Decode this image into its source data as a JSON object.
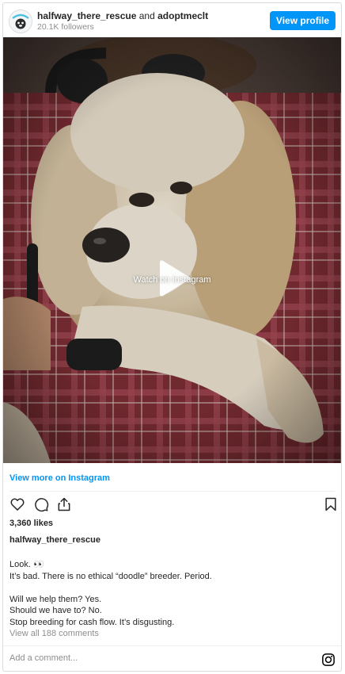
{
  "header": {
    "username": "halfway_there_rescue",
    "and_text": "and",
    "collaborator": "adoptmeclt",
    "followers": "20.1K followers",
    "view_profile_label": "View profile"
  },
  "media": {
    "watch_label": "Watch on Instagram"
  },
  "view_more_label": "View more on Instagram",
  "icons": [
    "heart-icon",
    "comment-icon",
    "share-icon",
    "bookmark-icon"
  ],
  "likes": "3,360 likes",
  "caption": {
    "username": "halfway_there_rescue",
    "lines": [
      "Look. 👀",
      "It’s bad. There is no ethical “doodle” breeder. Period.",
      "",
      "Will we help them? Yes.",
      "Should we have to? No.",
      "Stop breeding for cash flow. It’s disgusting."
    ]
  },
  "view_comments_label": "View all 188 comments",
  "comment": {
    "placeholder": "Add a comment..."
  },
  "colors": {
    "accent": "#0095f6",
    "muted": "#8e8e8e",
    "text": "#262626"
  }
}
